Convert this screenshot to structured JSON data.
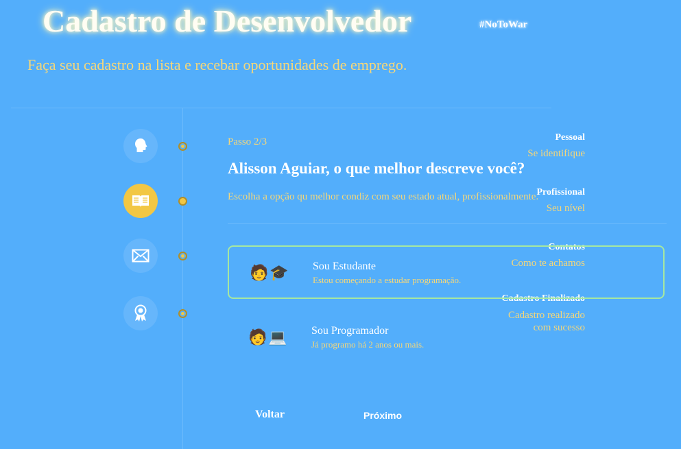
{
  "header": {
    "title": "Cadastro de Desenvolvedor",
    "tag": "#NoToWar",
    "subtitle": "Faça seu cadastro na lista e recebar oportunidades de emprego."
  },
  "steps": [
    {
      "title": "Pessoal",
      "subtitle": "Se identifique",
      "icon": "head-icon",
      "active": false
    },
    {
      "title": "Profissional",
      "subtitle": "Seu nível",
      "icon": "book-icon",
      "active": true
    },
    {
      "title": "Contatos",
      "subtitle": "Como te achamos",
      "icon": "envelope-icon",
      "active": false
    },
    {
      "title": "Cadastro Finalizado",
      "subtitle": "Cadastro realizado com sucesso",
      "icon": "award-icon",
      "active": false
    }
  ],
  "form": {
    "step_label": "Passo 2/3",
    "question": "Alisson Aguiar, o que melhor descreve você?",
    "hint": "Escolha a opção qu melhor condiz com seu estado atual, profissionalmente.",
    "options": [
      {
        "emoji": "🧑🎓",
        "title": "Sou Estudante",
        "description": "Estou começando a estudar programação.",
        "selected": true
      },
      {
        "emoji": "🧑💻",
        "title": "Sou Programador",
        "description": "Já programo há 2 anos ou mais.",
        "selected": false
      }
    ],
    "back_label": "Voltar",
    "next_label": "Próximo"
  },
  "colors": {
    "background": "#53aefb",
    "accent": "#f2c744",
    "muted_text": "#f5d77a",
    "selected_border": "#a6e8a0"
  }
}
